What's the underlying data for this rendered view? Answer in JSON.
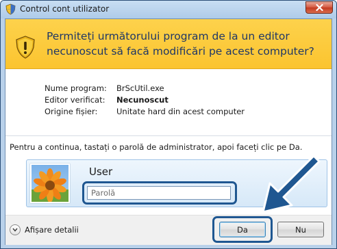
{
  "window": {
    "title": "Control cont utilizator",
    "colors": {
      "banner": "#fbc42f",
      "banner_text": "#1f3766",
      "highlight": "#1f5791",
      "close": "#c23a21"
    }
  },
  "banner": {
    "icon": "uac-warning-shield-icon",
    "line1": "Permiteți următorului program de la un editor",
    "line2": "necunoscut să facă modificări pe acest computer?"
  },
  "details": [
    {
      "label": "Nume program:",
      "value": "BrScUtil.exe",
      "bold": false
    },
    {
      "label": "Editor verificat:",
      "value": "Necunoscut",
      "bold": true
    },
    {
      "label": "Origine fișier:",
      "value": "Unitate hard din acest computer",
      "bold": false
    }
  ],
  "instruction": "Pentru a continua, tastați o parolă de administrator, apoi faceți clic pe Da.",
  "credential": {
    "avatar": "flower-avatar-icon",
    "username": "User",
    "password_placeholder": "Parolă"
  },
  "footer": {
    "show_details": "Afișare detalii",
    "yes_button": "Da",
    "no_button": "Nu"
  }
}
